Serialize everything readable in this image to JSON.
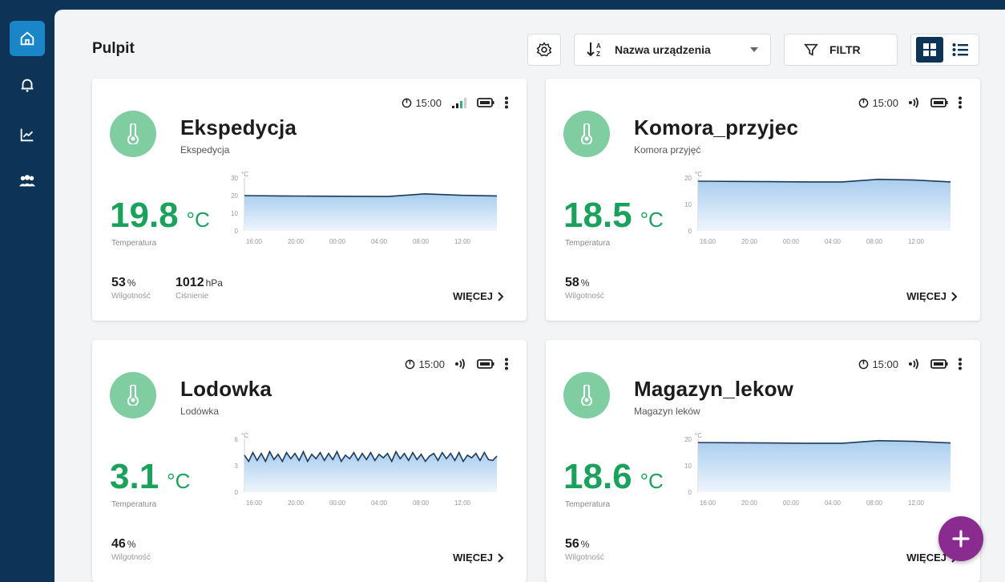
{
  "app": {
    "page_title": "Pulpit",
    "colors": {
      "nav_bg": "#0d3356",
      "nav_active": "#1a86c7",
      "temp_green": "#1aa15b",
      "avatar_green": "#7fcda1",
      "fab_purple": "#8a2b8f"
    }
  },
  "sidebar": {
    "items": [
      {
        "name": "home",
        "icon": "home-icon",
        "active": true
      },
      {
        "name": "alerts",
        "icon": "bell-icon",
        "active": false
      },
      {
        "name": "charts",
        "icon": "chart-icon",
        "active": false
      },
      {
        "name": "users",
        "icon": "users-icon",
        "active": false
      }
    ]
  },
  "toolbar": {
    "sort_label": "Nazwa urządzenia",
    "filter_label": "FILTR"
  },
  "chart_axis": {
    "x_ticks": [
      "16:00",
      "20:00",
      "00:00",
      "04:00",
      "08:00",
      "12:00"
    ],
    "unit": "°C"
  },
  "cards": [
    {
      "title": "Ekspedycja",
      "subtitle": "Ekspedycja",
      "time": "15:00",
      "signal": "bars",
      "temp": "19.8",
      "temp_unit": "°C",
      "temp_label": "Temperatura",
      "humidity": "53",
      "humidity_unit": "%",
      "humidity_label": "Wilgotność",
      "pressure": "1012",
      "pressure_unit": "hPa",
      "pressure_label": "Ciśnienie",
      "more": "WIĘCEJ",
      "chart_data": {
        "type": "area",
        "ylim": [
          0,
          30
        ],
        "y_ticks": [
          "30",
          "20",
          "10",
          "0"
        ],
        "x": [
          "16:00",
          "20:00",
          "00:00",
          "04:00",
          "08:00",
          "12:00",
          "15:00"
        ],
        "values": [
          20,
          19.8,
          19.7,
          19.6,
          19.5,
          21,
          20.2,
          19.8
        ]
      }
    },
    {
      "title": "Komora_przyjec",
      "subtitle": "Komora przyjęć",
      "time": "15:00",
      "signal": "wifi",
      "temp": "18.5",
      "temp_unit": "°C",
      "temp_label": "Temperatura",
      "humidity": "58",
      "humidity_unit": "%",
      "humidity_label": "Wilgotność",
      "more": "WIĘCEJ",
      "chart_data": {
        "type": "area",
        "ylim": [
          0,
          20
        ],
        "y_ticks": [
          "20",
          "10",
          "0"
        ],
        "values": [
          18.8,
          18.7,
          18.6,
          18.5,
          18.5,
          19.5,
          19.2,
          18.5
        ]
      }
    },
    {
      "title": "Lodowka",
      "subtitle": "Lodówka",
      "time": "15:00",
      "signal": "wifi",
      "temp": "3.1",
      "temp_unit": "°C",
      "temp_label": "Temperatura",
      "humidity": "46",
      "humidity_unit": "%",
      "humidity_label": "Wilgotność",
      "more": "WIĘCEJ",
      "chart_data": {
        "type": "area",
        "ylim": [
          0,
          6
        ],
        "y_ticks": [
          "6",
          "3",
          "0"
        ],
        "values": [
          4.2,
          3.5,
          4.5,
          3.6,
          4.4,
          3.5,
          4.6,
          3.7,
          4.3,
          3.5,
          4.5,
          3.8,
          4.4,
          3.6,
          4.6,
          3.5,
          4.3,
          3.8,
          4.5,
          3.6,
          4.4,
          3.7,
          4.6,
          3.5,
          4.2,
          3.8,
          4.5,
          3.6,
          4.4,
          3.7,
          4.5,
          3.6,
          4.3,
          3.9,
          4.4,
          3.5,
          4.6,
          3.8,
          4.4,
          3.6,
          4.5,
          3.7,
          4.3,
          3.5,
          4.1,
          4.4,
          3.6,
          4.5,
          3.8,
          4.4,
          3.6,
          4.5,
          3.5,
          4.2,
          3.9,
          4.4,
          3.6,
          4.5,
          3.7,
          3.6,
          4.1
        ]
      }
    },
    {
      "title": "Magazyn_lekow",
      "subtitle": "Magazyn leków",
      "time": "15:00",
      "signal": "wifi",
      "temp": "18.6",
      "temp_unit": "°C",
      "temp_label": "Temperatura",
      "humidity": "56",
      "humidity_unit": "%",
      "humidity_label": "Wilgotność",
      "more": "WIĘCEJ",
      "chart_data": {
        "type": "area",
        "ylim": [
          0,
          20
        ],
        "y_ticks": [
          "20",
          "10",
          "0"
        ],
        "values": [
          18.8,
          18.7,
          18.6,
          18.5,
          18.5,
          19.5,
          19.2,
          18.6
        ]
      }
    }
  ]
}
